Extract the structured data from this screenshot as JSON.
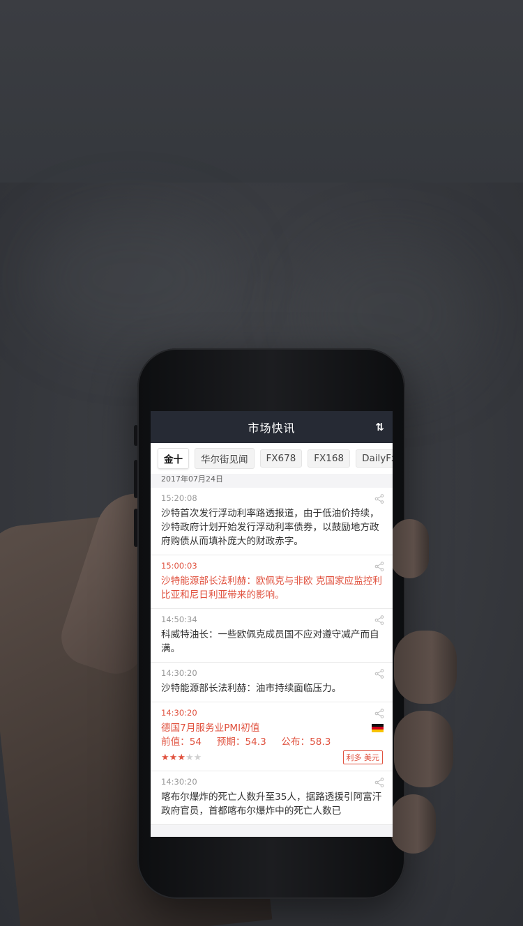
{
  "nav": {
    "title": "市场快讯",
    "sort_icon": "⇅"
  },
  "tabs": [
    {
      "label": "金十",
      "active": true
    },
    {
      "label": "华尔街见闻",
      "active": false
    },
    {
      "label": "FX678",
      "active": false
    },
    {
      "label": "FX168",
      "active": false
    },
    {
      "label": "DailyFx",
      "active": false
    }
  ],
  "date": "2017年07月24日",
  "news": [
    {
      "time": "15:20:08",
      "text": "沙特首次发行浮动利率路透报道，由于低油价持续，沙特政府计划开始发行浮动利率债券，以鼓励地方政府购债从而填补庞大的财政赤字。",
      "highlight": false
    },
    {
      "time": "15:00:03",
      "text": "沙特能源部长法利赫：欧佩克与非欧 克国家应监控利比亚和尼日利亚带来的影响。",
      "highlight": true
    },
    {
      "time": "14:50:34",
      "text": "科威特油长：一些欧佩克成员国不应对遵守减产而自满。",
      "highlight": false
    },
    {
      "time": "14:30:20",
      "text": "沙特能源部长法利赫：油市持续面临压力。",
      "highlight": false
    }
  ],
  "econ": {
    "time": "14:30:20",
    "title": "德国7月服务业PMI初值",
    "previous_label": "前值：",
    "previous": "54",
    "forecast_label": "预期：",
    "forecast": "54.3",
    "actual_label": "公布：",
    "actual": "58.3",
    "stars": 3,
    "stars_total": 5,
    "tag": "利多 美元",
    "flag_icon": "germany-flag",
    "colors": {
      "accent": "#e0523f"
    }
  },
  "last_news": {
    "time": "14:30:20",
    "text": "喀布尔爆炸的死亡人数升至35人，据路透援引阿富汗政府官员，首都喀布尔爆炸中的死亡人数已"
  }
}
